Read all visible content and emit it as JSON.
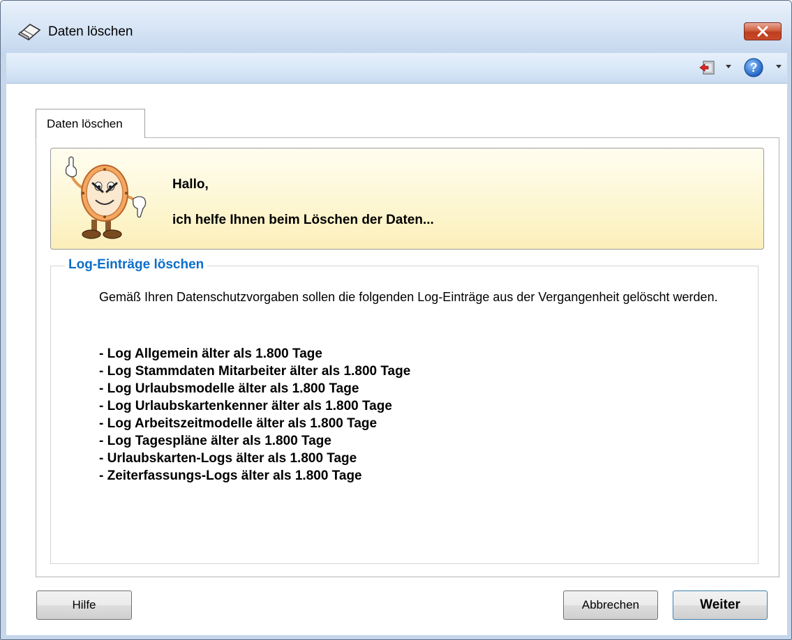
{
  "window": {
    "title": "Daten löschen",
    "close_icon": "close-icon"
  },
  "toolbar": {
    "exit_icon": "exit-door-icon",
    "help_icon": "help-icon"
  },
  "tabs": [
    {
      "label": "Daten löschen",
      "selected": true
    }
  ],
  "banner": {
    "greeting": "Hallo,",
    "message": "ich helfe Ihnen beim Löschen der Daten...",
    "mascot_icon": "clock-mascot-icon"
  },
  "log_section": {
    "title": "Log-Einträge löschen",
    "intro": "Gemäß Ihren Datenschutzvorgaben sollen die folgenden Log-Einträge aus der Vergangenheit gelöscht werden.",
    "items": [
      "- Log Allgemein älter als 1.800 Tage",
      "- Log Stammdaten Mitarbeiter älter als 1.800 Tage",
      "- Log Urlaubsmodelle älter als 1.800 Tage",
      "- Log Urlaubskartenkenner älter als 1.800 Tage",
      "- Log Arbeitszeitmodelle älter als 1.800 Tage",
      "- Log Tagespläne älter als 1.800 Tage",
      "- Urlaubskarten-Logs älter als 1.800 Tage",
      "- Zeiterfassungs-Logs älter als 1.800 Tage"
    ]
  },
  "buttons": {
    "help": "Hilfe",
    "cancel": "Abbrechen",
    "next": "Weiter"
  },
  "colors": {
    "section_title": "#0c6ec9",
    "banner_bg": "#fdf7d6",
    "close_button": "#c94a2a"
  }
}
